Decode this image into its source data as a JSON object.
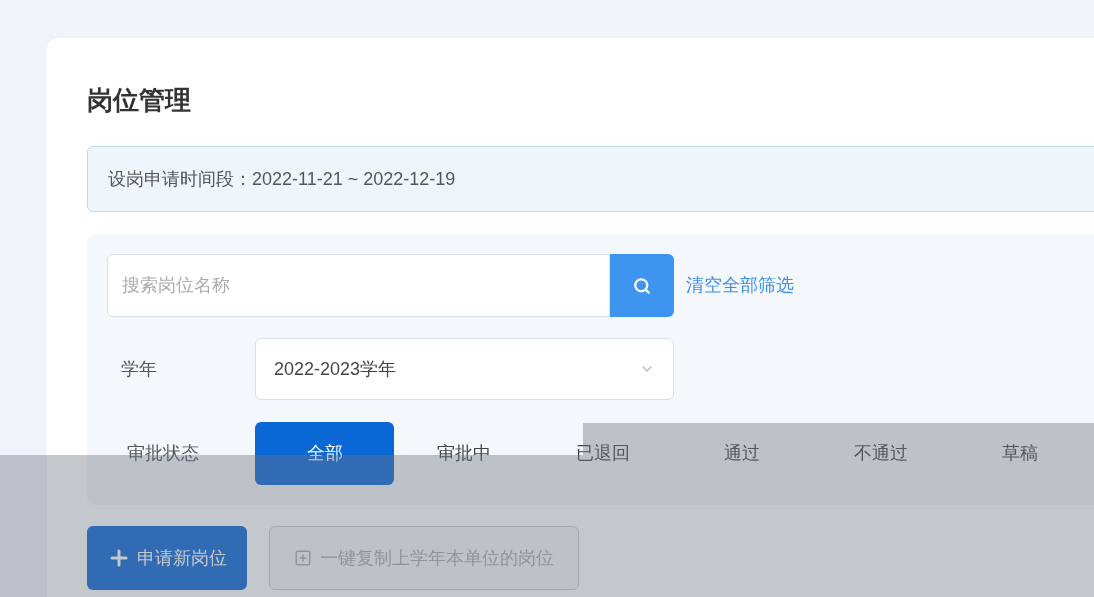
{
  "page": {
    "title": "岗位管理"
  },
  "notice": "设岗申请时间段：2022-11-21 ~ 2022-12-19",
  "search": {
    "placeholder": "搜索岗位名称",
    "clear_link": "清空全部筛选"
  },
  "year_filter": {
    "label": "学年",
    "value": "2022-2023学年"
  },
  "status_filter": {
    "label": "审批状态",
    "tabs": [
      {
        "label": "全部",
        "selected": true
      },
      {
        "label": "审批中",
        "selected": false
      },
      {
        "label": "已退回",
        "selected": false
      },
      {
        "label": "通过",
        "selected": false
      },
      {
        "label": "不通过",
        "selected": false
      },
      {
        "label": "草稿",
        "selected": false
      }
    ]
  },
  "actions": [
    {
      "kind": "primary",
      "label": "申请新岗位",
      "disabled": false
    },
    {
      "kind": "copy",
      "label": "一键复制上学年本单位的岗位",
      "disabled": true
    }
  ]
}
